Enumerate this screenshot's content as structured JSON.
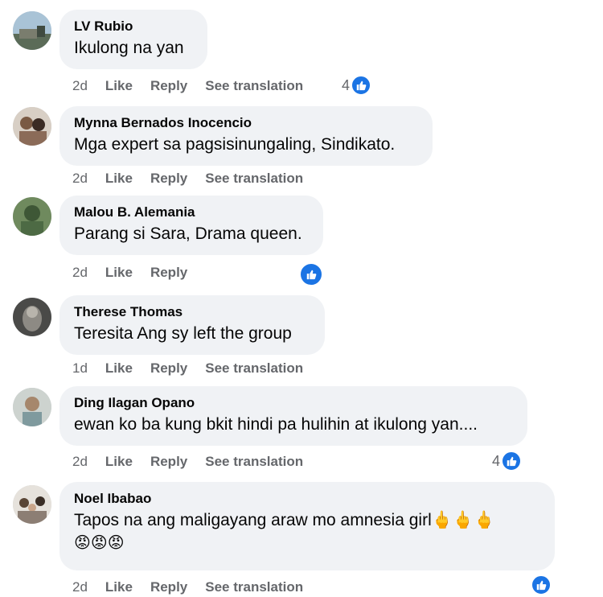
{
  "colors": {
    "like_blue": "#1b74e4",
    "bubble_bg": "#f0f2f5",
    "meta_gray": "#65676b"
  },
  "comments": [
    {
      "author": "LV Rubio",
      "text": "Ikulong na yan",
      "time": "2d",
      "like": "Like",
      "reply": "Reply",
      "translate": "See translation",
      "reactions": "4",
      "reaction_icon": "thumbs-up-icon"
    },
    {
      "author": "Mynna Bernados Inocencio",
      "text": "Mga expert sa pagsisinungaling, Sindikato.",
      "time": "2d",
      "like": "Like",
      "reply": "Reply",
      "translate": "See translation"
    },
    {
      "author": "Malou B. Alemania",
      "text": "Parang si Sara, Drama queen.",
      "time": "2d",
      "like": "Like",
      "reply": "Reply",
      "reaction_icon": "thumbs-up-icon"
    },
    {
      "author": "Therese Thomas",
      "text": "Teresita Ang sy left the group",
      "time": "1d",
      "like": "Like",
      "reply": "Reply",
      "translate": "See translation"
    },
    {
      "author": "Ding Ilagan Opano",
      "text": "ewan ko ba kung bkit hindi pa hulihin at ikulong yan....",
      "time": "2d",
      "like": "Like",
      "reply": "Reply",
      "translate": "See translation",
      "reactions": "4",
      "reaction_icon": "thumbs-up-icon"
    },
    {
      "author": "Noel Ibabao",
      "text": "Tapos na ang maligayang araw mo amnesia girl",
      "text_emoji": "🖕🖕🖕",
      "emoji_line": "😡😡😡",
      "time": "2d",
      "like": "Like",
      "reply": "Reply",
      "translate": "See translation",
      "reaction_icon": "thumbs-up-icon"
    }
  ]
}
